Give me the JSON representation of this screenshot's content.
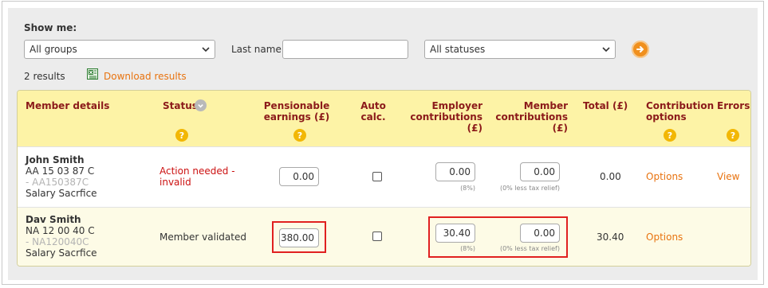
{
  "filters": {
    "show_me_label": "Show me:",
    "group_select": "All groups",
    "last_name_label": "Last name",
    "last_name_value": "",
    "status_select": "All statuses"
  },
  "results": {
    "count_text": "2 results",
    "download_label": "Download results"
  },
  "table": {
    "headers": {
      "member_details": "Member details",
      "status": "Status",
      "pensionable_line1": "Pensionable",
      "pensionable_line2": "earnings (£)",
      "auto_line1": "Auto",
      "auto_line2": "calc.",
      "employer_line1": "Employer",
      "employer_line2": "contributions (£)",
      "member_line1": "Member",
      "member_line2": "contributions (£)",
      "total": "Total (£)",
      "contrib_line1": "Contribution",
      "contrib_line2": "options",
      "errors": "Errors"
    },
    "help_glyph": "?",
    "rows": [
      {
        "name": "John Smith",
        "ni": "AA 15 03 87 C",
        "ref": "- AA150387C",
        "scheme": "Salary Sacrfice",
        "status_line1": "Action needed -",
        "status_line2": "invalid",
        "pensionable": "0.00",
        "auto_calc": false,
        "employer": "0.00",
        "employer_note": "(8%)",
        "member": "0.00",
        "member_note": "(0% less tax relief)",
        "total": "0.00",
        "options_label": "Options",
        "errors_label": "View"
      },
      {
        "name": "Dav Smith",
        "ni": "NA 12 00 40 C",
        "ref": "- NA120040C",
        "scheme": "Salary Sacrfice",
        "status_line1": "Member validated",
        "pensionable": "380.00",
        "auto_calc": false,
        "employer": "30.40",
        "employer_note": "(8%)",
        "member": "0.00",
        "member_note": "(0% less tax relief)",
        "total": "30.40",
        "options_label": "Options"
      }
    ]
  },
  "colors": {
    "header_bg": "#fdf3a6",
    "header_text": "#8b1a1a",
    "link": "#e8730f",
    "error": "#cc1111",
    "highlight": "#e02020",
    "help_badge": "#f2b705"
  }
}
